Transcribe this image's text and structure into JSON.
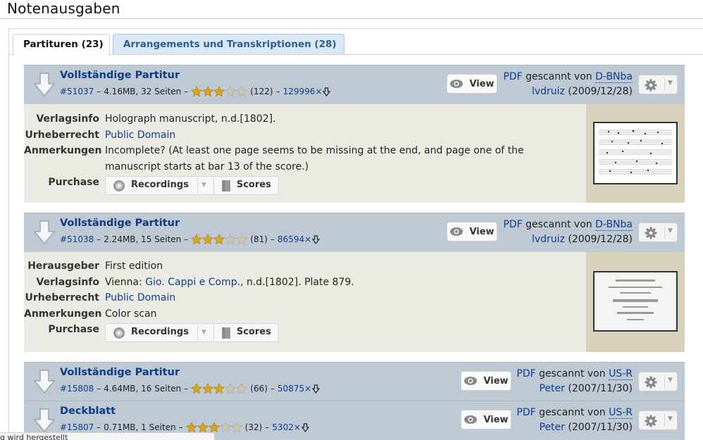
{
  "page": {
    "title": "Notenausgaben"
  },
  "tabs": [
    {
      "label": "Partituren (23)",
      "active": true
    },
    {
      "label": "Arrangements und Transkriptionen (28)",
      "active": false
    }
  ],
  "common": {
    "view_label": "View",
    "pdf_label": "PDF",
    "scanned_by": "gescannt von",
    "purchase_recordings": "Recordings",
    "purchase_scores": "Scores"
  },
  "files": [
    {
      "title": "Vollständige Partitur",
      "id": "#51037",
      "size": "4.16MB, 32 Seiten",
      "rating": 3,
      "votes": "(122)",
      "downloads": "129996×",
      "scanner": "D-BNba",
      "uploader": "lvdruiz",
      "date": "(2009/12/28)",
      "details": [
        {
          "key": "Verlagsinfo",
          "value": "Holograph manuscript, n.d.[1802]."
        },
        {
          "key": "Urheberrecht",
          "value": "Public Domain"
        },
        {
          "key": "Anmerkungen",
          "value": "Incomplete? (At least one page seems to be missing at the end, and page one of the manuscript starts at bar 13 of the score.)"
        },
        {
          "key": "Purchase"
        }
      ]
    },
    {
      "title": "Vollständige Partitur",
      "id": "#51038",
      "size": "2.24MB, 15 Seiten",
      "rating": 3,
      "votes": "(81)",
      "downloads": "86594×",
      "scanner": "D-BNba",
      "uploader": "lvdruiz",
      "date": "(2009/12/28)",
      "details": [
        {
          "key": "Herausgeber",
          "value": "First edition"
        },
        {
          "key": "Verlagsinfo",
          "value_prefix": "Vienna: ",
          "value_link": "Gio. Cappi e Comp.",
          "value_suffix": ", n.d.[1802]. Plate 879."
        },
        {
          "key": "Urheberrecht",
          "value": "Public Domain"
        },
        {
          "key": "Anmerkungen",
          "value": "Color scan"
        },
        {
          "key": "Purchase"
        }
      ]
    },
    {
      "title": "Vollständige Partitur",
      "id": "#15808",
      "size": "4.64MB, 16 Seiten",
      "rating": 3,
      "votes": "(66)",
      "downloads": "50875×",
      "scanner": "US-R",
      "uploader": "Peter",
      "date": "(2007/11/30)"
    },
    {
      "title": "Deckblatt",
      "id": "#15807",
      "size": "0.71MB, 1 Seiten",
      "rating": 3,
      "votes": "(32)",
      "downloads": "5302×",
      "scanner": "US-R",
      "uploader": "Peter",
      "date": "(2007/11/30)"
    }
  ],
  "status": {
    "text": "g wird hergestellt"
  },
  "colors": {
    "link": "#0b3d91",
    "header_bg": "#bfc9d3",
    "detail_bg": "#ecebe3",
    "thumb_bg": "#d8d2bd",
    "star_gold": "#d9a520"
  }
}
